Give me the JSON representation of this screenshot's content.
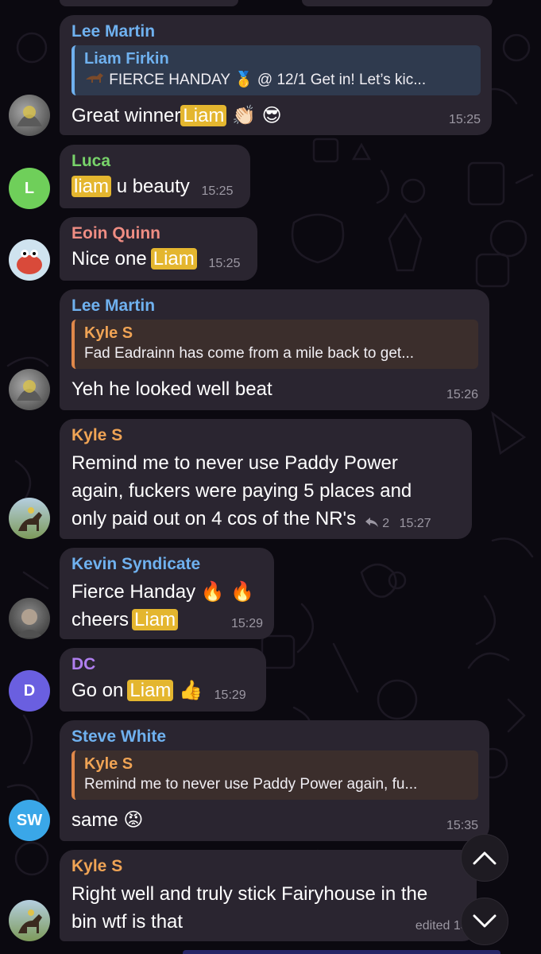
{
  "colors": {
    "background": "#0b0910",
    "bubble": "#2a2530",
    "highlight": "#e4b62f",
    "lee_martin": "#6fb1ef",
    "luca": "#78d36a",
    "eoin_quinn": "#ef8d83",
    "kyle_s": "#f0a455",
    "kevin_syndicate": "#6fb1ef",
    "dc": "#b07ff0",
    "steve_white": "#6fb1ef"
  },
  "messages": [
    {
      "sender": "Lee Martin",
      "reply": {
        "name": "Liam Firkin",
        "text": "FIERCE HANDAY",
        "medal": "🥇",
        "suffix": "@ 12/1 Get in! Let’s kic..."
      },
      "text_before": "Great winner",
      "highlight": "Liam",
      "emoji": "👏🏻 😎",
      "time": "15:25"
    },
    {
      "sender": "Luca",
      "highlight": "liam",
      "text_after": "u beauty",
      "time": "15:25",
      "avatar_letter": "L"
    },
    {
      "sender": "Eoin Quinn",
      "text_before": "Nice one",
      "highlight": "Liam",
      "time": "15:25"
    },
    {
      "sender": "Lee Martin",
      "reply": {
        "name": "Kyle S",
        "text": "Fad Eadrainn has come from a mile back to get..."
      },
      "text": "Yeh he looked well beat",
      "time": "15:26"
    },
    {
      "sender": "Kyle S",
      "lines": [
        "Remind me to never use Paddy Power",
        "again, fuckers were paying 5 places and",
        "only paid out on 4 cos of the NR's"
      ],
      "reply_count": "2",
      "time": "15:27"
    },
    {
      "sender": "Kevin Syndicate",
      "line1": "Fierce Handay",
      "line1_emoji": "🔥 🔥",
      "line2_before": "cheers",
      "highlight": "Liam",
      "time": "15:29"
    },
    {
      "sender": "DC",
      "text_before": "Go on",
      "highlight": "Liam",
      "emoji": "👍",
      "time": "15:29",
      "avatar_letter": "D"
    },
    {
      "sender": "Steve White",
      "reply": {
        "name": "Kyle S",
        "text": "Remind me to never use Paddy Power again, fu..."
      },
      "text": "same",
      "emoji": "😡",
      "time": "15:35",
      "avatar_letters": "SW"
    },
    {
      "sender": "Kyle S",
      "lines": [
        "Right well and truly stick Fairyhouse in the",
        "bin wtf is that"
      ],
      "time": "edited 15:5"
    }
  ]
}
